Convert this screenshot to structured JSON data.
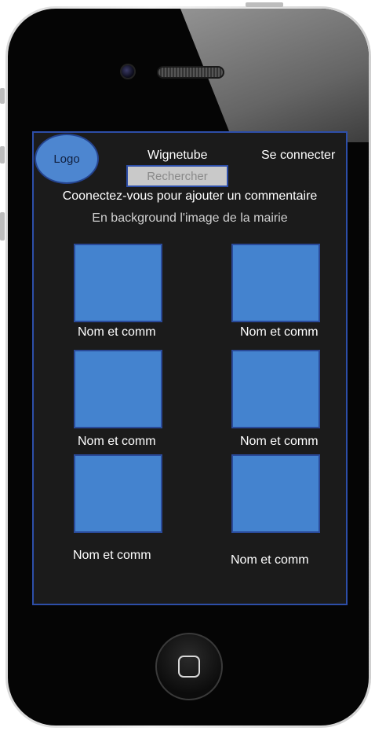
{
  "header": {
    "logo_label": "Logo",
    "app_title": "Wignetube",
    "login_label": "Se connecter"
  },
  "search": {
    "placeholder": "Rechercher"
  },
  "messages": {
    "connect_prompt": "Coonectez-vous pour ajouter un commentaire",
    "background_note": "En background l'image de la mairie"
  },
  "gallery": {
    "items": [
      {
        "caption": "Nom et comm"
      },
      {
        "caption": "Nom et comm"
      },
      {
        "caption": "Nom et comm"
      },
      {
        "caption": "Nom et comm"
      },
      {
        "caption": "Nom et comm"
      },
      {
        "caption": "Nom et comm"
      }
    ]
  },
  "device": {
    "home_icon": "home-square-icon",
    "camera_icon": "front-camera-icon",
    "speaker_icon": "earpiece-speaker-icon"
  },
  "colors": {
    "screen_background": "#1b1b1b",
    "accent_blue": "#4483cf",
    "border_blue": "#2d4ea8",
    "text": "#ffffff"
  }
}
